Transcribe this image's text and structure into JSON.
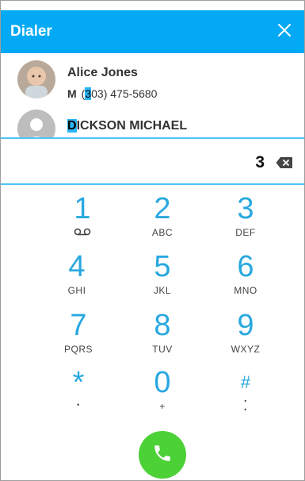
{
  "header": {
    "title": "Dialer"
  },
  "contacts": [
    {
      "name": "Alice Jones",
      "phone_type": "M",
      "phone_prefix": "(",
      "phone_highlight": "3",
      "phone_rest": "03) 475-5680"
    },
    {
      "name_highlight": "D",
      "name_rest": "ICKSON MICHAEL"
    }
  ],
  "input": {
    "digits": "3"
  },
  "keypad": [
    {
      "digit": "1",
      "sub": ""
    },
    {
      "digit": "2",
      "sub": "ABC"
    },
    {
      "digit": "3",
      "sub": "DEF"
    },
    {
      "digit": "4",
      "sub": "GHI"
    },
    {
      "digit": "5",
      "sub": "JKL"
    },
    {
      "digit": "6",
      "sub": "MNO"
    },
    {
      "digit": "7",
      "sub": "PQRS"
    },
    {
      "digit": "8",
      "sub": "TUV"
    },
    {
      "digit": "9",
      "sub": "WXYZ"
    },
    {
      "digit": "*",
      "sub": "•"
    },
    {
      "digit": "0",
      "sub": "+"
    },
    {
      "digit": "#",
      "sub": "⁚"
    }
  ],
  "icons": {
    "voicemail": "voicemail-icon",
    "backspace": "backspace-icon",
    "call": "phone-icon",
    "close": "close-icon"
  },
  "colors": {
    "header": "#03a9f4",
    "accent": "#29a8e0",
    "call_button": "#4cd137",
    "highlight": "#29b6f6"
  }
}
